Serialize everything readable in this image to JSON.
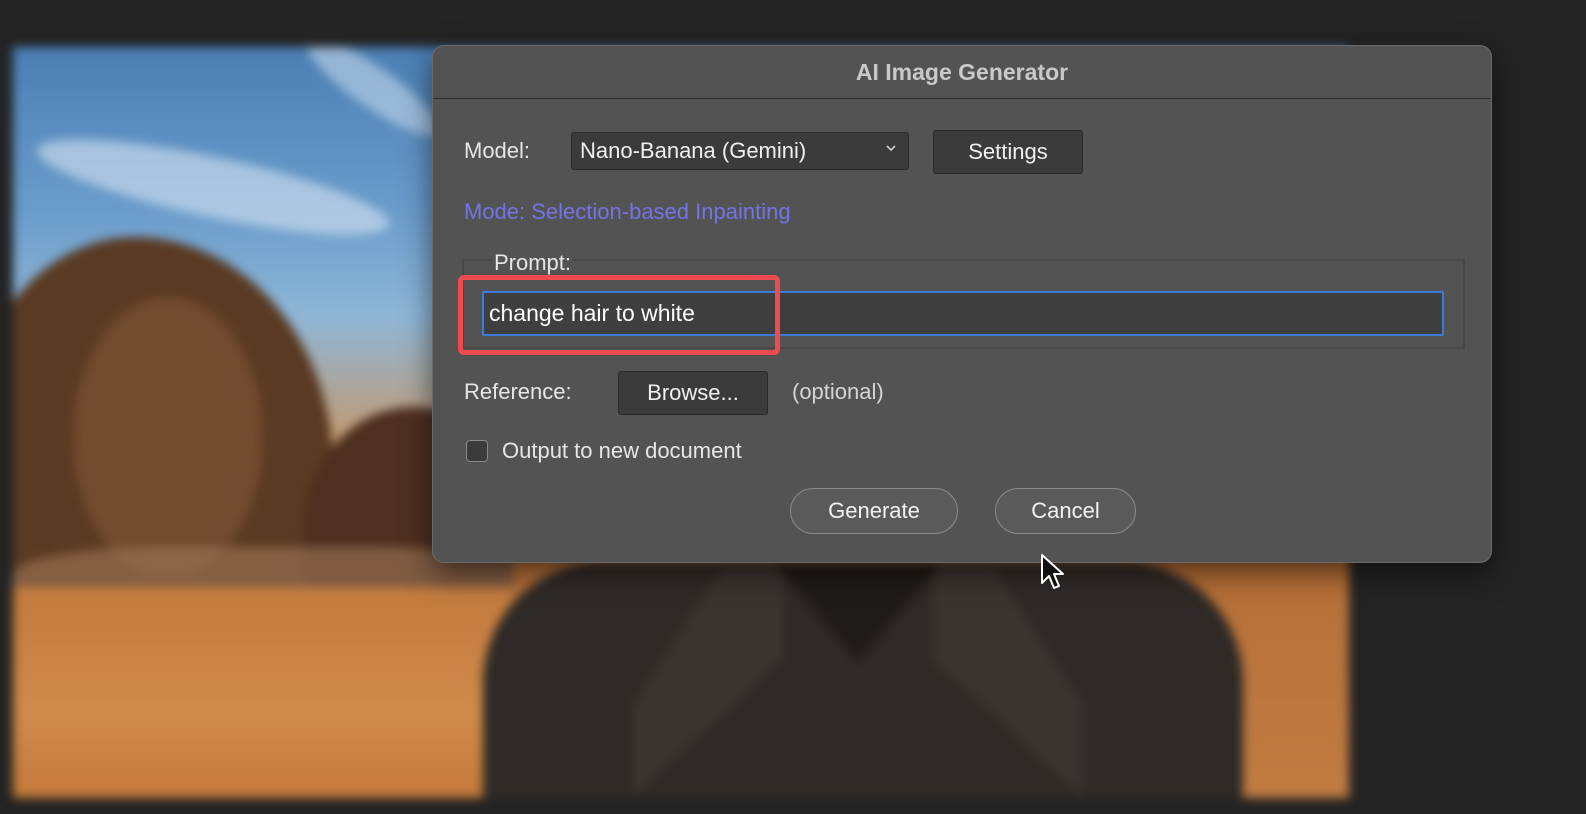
{
  "dialog": {
    "title": "AI Image Generator",
    "model_label": "Model:",
    "model_selected": "Nano-Banana (Gemini)",
    "settings_label": "Settings",
    "mode_text": "Mode: Selection-based Inpainting",
    "prompt_legend": "Prompt:",
    "prompt_value": "change hair to white",
    "reference_label": "Reference:",
    "browse_label": "Browse...",
    "optional_text": "(optional)",
    "output_checkbox_label": "Output to new document",
    "output_checkbox_checked": false,
    "generate_label": "Generate",
    "cancel_label": "Cancel"
  },
  "colors": {
    "mode_text": "#7474e6",
    "highlight": "#ef4a4f",
    "input_focus": "#3d7bd9"
  },
  "icons": {
    "model_dropdown": "chevron-down-icon",
    "pointer": "mouse-pointer-icon"
  }
}
